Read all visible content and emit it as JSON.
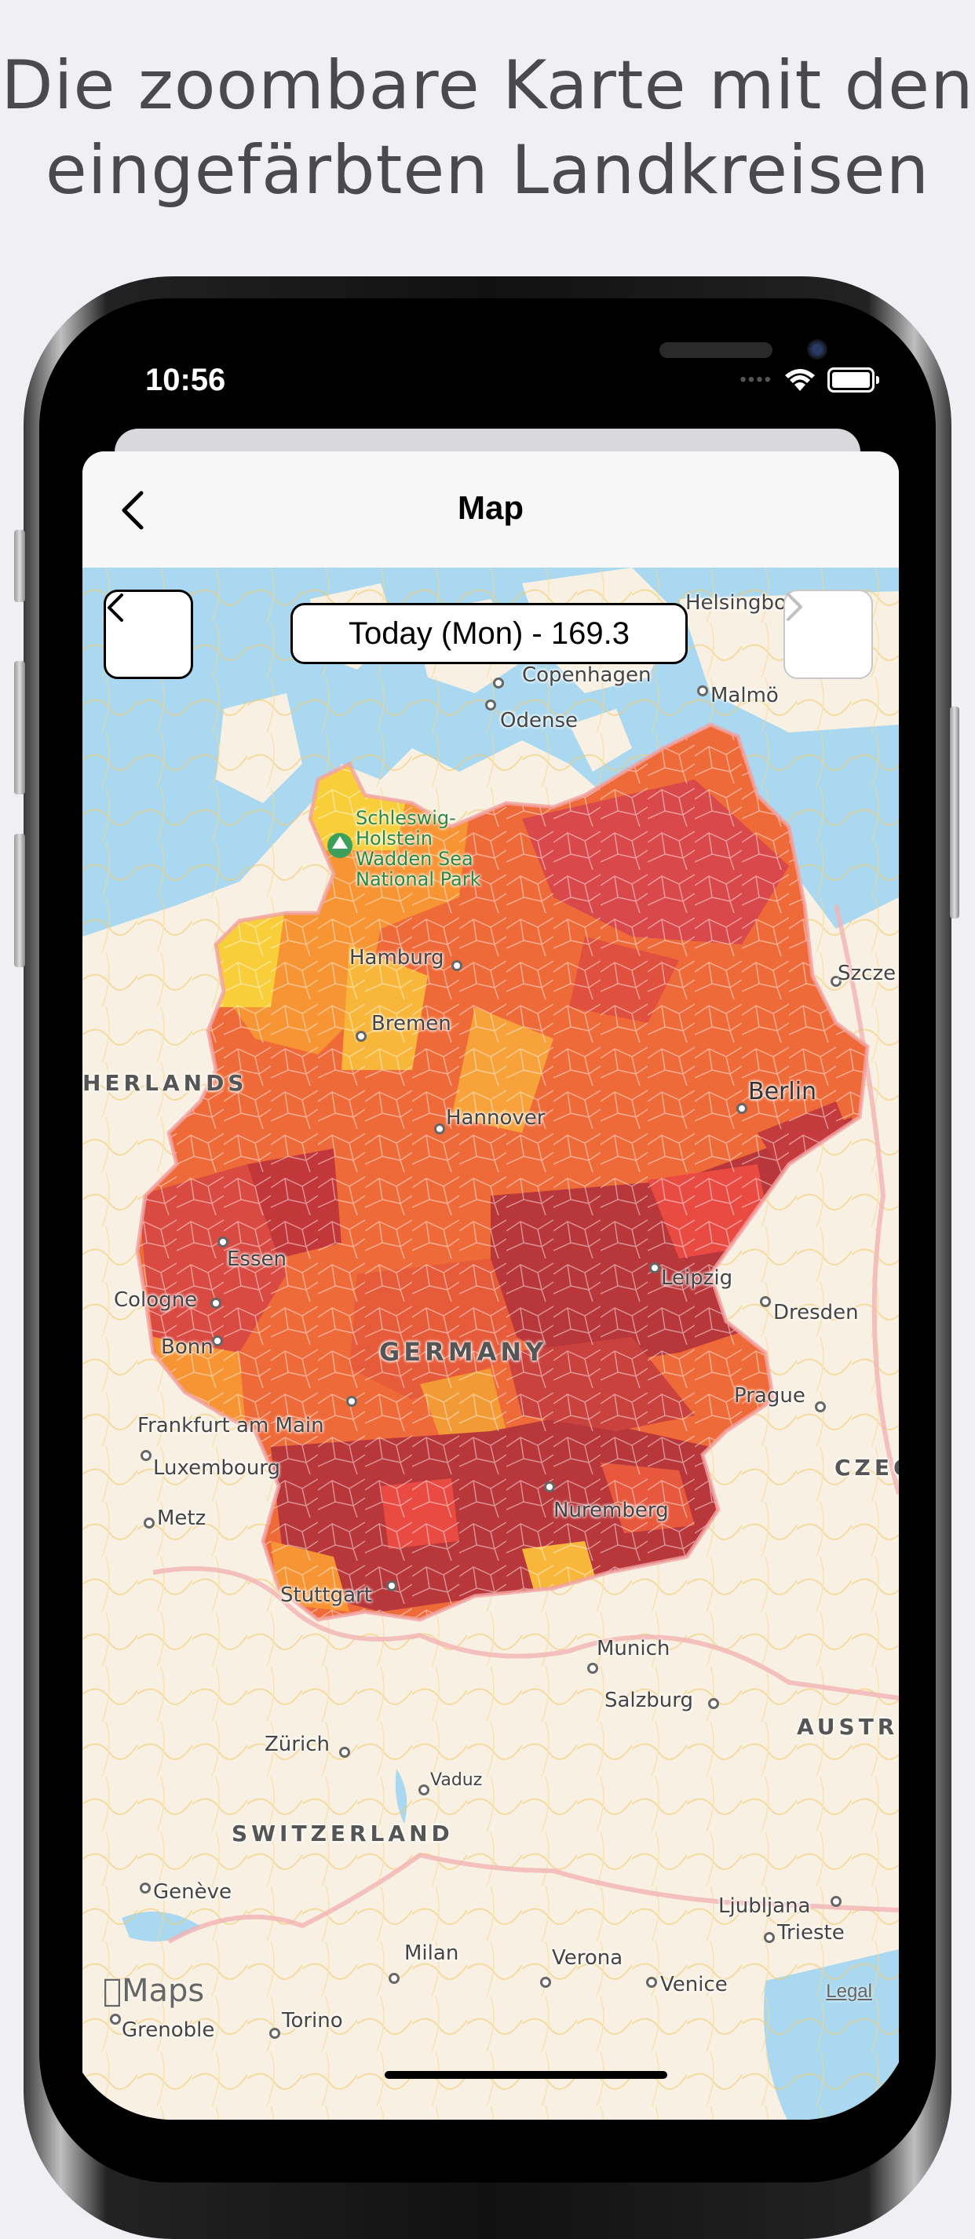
{
  "headline": {
    "line1": "Die zoombare Karte mit den",
    "line2": "eingefärbten Landkreisen"
  },
  "status_bar": {
    "time": "10:56",
    "icons": [
      "wifi-icon",
      "battery-icon"
    ]
  },
  "nav": {
    "title": "Map",
    "back_icon": "chevron-left-icon"
  },
  "map_controls": {
    "prev_icon": "chevron-left-icon",
    "next_icon": "chevron-right-icon",
    "date_label": "Today (Mon) - 169.3",
    "next_enabled": false
  },
  "map_labels": {
    "helsingborg": "Helsingbo",
    "copenhagen": "Copenhagen",
    "malmo": "Malmö",
    "odense": "Odense",
    "park_l1": "Schleswig-",
    "park_l2": "Holstein",
    "park_l3": "Wadden Sea",
    "park_l4": "National Park",
    "hamburg": "Hamburg",
    "szczecin": "Szcze",
    "bremen": "Bremen",
    "netherlands": "HERLANDS",
    "berlin": "Berlin",
    "hannover": "Hannover",
    "essen": "Essen",
    "leipzig": "Leipzig",
    "cologne": "Cologne",
    "dresden": "Dresden",
    "bonn": "Bonn",
    "germany": "GERMANY",
    "prague": "Prague",
    "frankfurt": "Frankfurt am Main",
    "czech": "CZEC",
    "luxembourg": "Luxembourg",
    "metz": "Metz",
    "nuremberg": "Nuremberg",
    "stuttgart": "Stuttgart",
    "munich": "Munich",
    "salzburg": "Salzburg",
    "austria": "AUSTRI",
    "zurich": "Zürich",
    "vaduz": "Vaduz",
    "switzerland": "SWITZERLAND",
    "geneve": "Genève",
    "ljubljana": "Ljubljana",
    "trieste": "Trieste",
    "milan": "Milan",
    "verona": "Verona",
    "venice": "Venice",
    "grenoble": "Grenoble",
    "torino": "Torino"
  },
  "attribution": {
    "maps": "Maps",
    "legal": "Legal"
  },
  "colors": {
    "sea": "#a9d8f0",
    "land": "#f8f1e3",
    "incidence_low": "#f8cf3a",
    "incidence_mid": "#f79433",
    "incidence_high": "#ef6a39",
    "incidence_very_high": "#c2373a"
  }
}
